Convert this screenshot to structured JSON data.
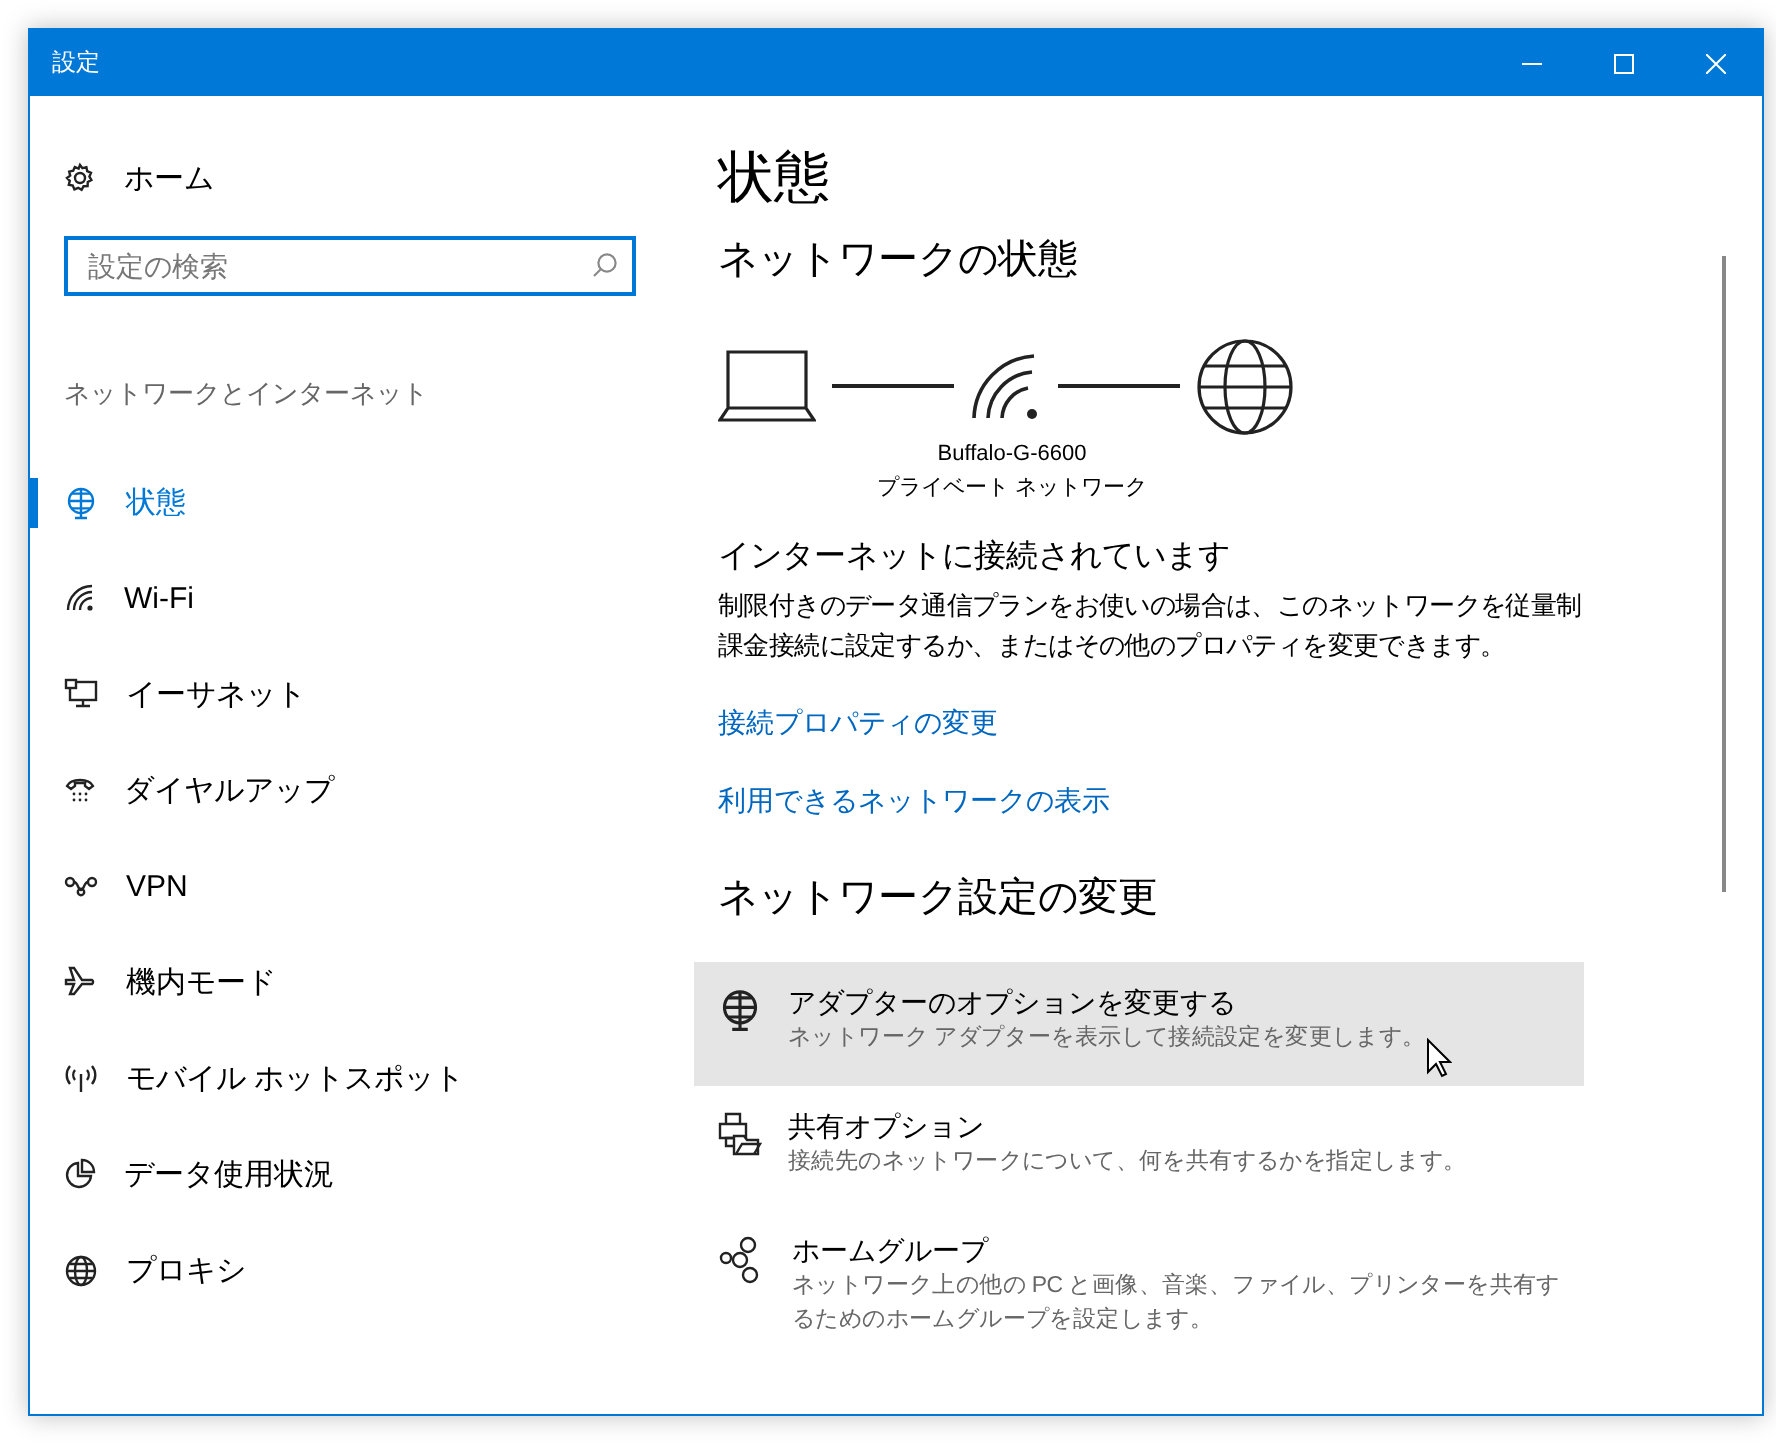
{
  "window": {
    "title": "設定"
  },
  "sidebar": {
    "home": "ホーム",
    "search": {
      "placeholder": "設定の検索"
    },
    "section": "ネットワークとインターネット",
    "items": [
      {
        "label": "状態",
        "selected": true
      },
      {
        "label": "Wi-Fi",
        "selected": false
      },
      {
        "label": "イーサネット",
        "selected": false
      },
      {
        "label": "ダイヤルアップ",
        "selected": false
      },
      {
        "label": "VPN",
        "selected": false
      },
      {
        "label": "機内モード",
        "selected": false
      },
      {
        "label": "モバイル ホットスポット",
        "selected": false
      },
      {
        "label": "データ使用状況",
        "selected": false
      },
      {
        "label": "プロキシ",
        "selected": false
      }
    ]
  },
  "content": {
    "title": "状態",
    "network_heading": "ネットワークの状態",
    "network": {
      "name": "Buffalo-G-6600",
      "type": "プライベート ネットワーク"
    },
    "status": "インターネットに接続されています",
    "description": "制限付きのデータ通信プランをお使いの場合は、このネットワークを従量制課金接続に設定するか、またはその他のプロパティを変更できます。",
    "links": [
      "接続プロパティの変更",
      "利用できるネットワークの表示"
    ],
    "change_heading": "ネットワーク設定の変更",
    "options": [
      {
        "title": "アダプターのオプションを変更する",
        "description": "ネットワーク アダプターを表示して接続設定を変更します。",
        "hovered": true
      },
      {
        "title": "共有オプション",
        "description": "接続先のネットワークについて、何を共有するかを指定します。",
        "hovered": false
      },
      {
        "title": "ホームグループ",
        "description": "ネットワーク上の他の PC と画像、音楽、ファイル、プリンターを共有するためのホームグループを設定します。",
        "hovered": false
      }
    ]
  }
}
